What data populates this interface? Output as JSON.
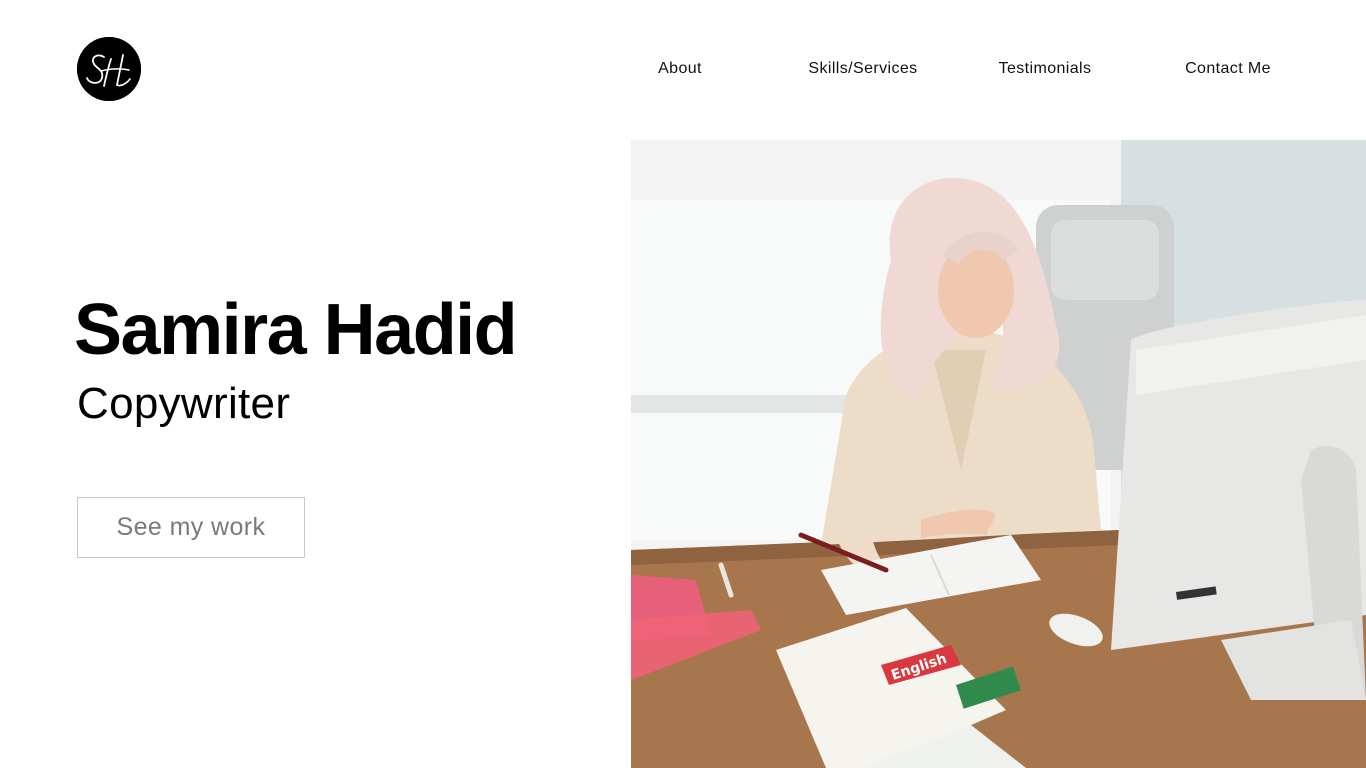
{
  "logo": {
    "monogram": "SH"
  },
  "nav": {
    "items": [
      "About",
      "Skills/Services",
      "Testimonials",
      "Contact Me"
    ]
  },
  "hero": {
    "name": "Samira Hadid",
    "role": "Copywriter",
    "cta_label": "See my work"
  },
  "photo": {
    "subject": "woman writing at desk with computer",
    "book_cover_text": "English"
  },
  "colors": {
    "text": "#000000",
    "button_text": "#7a7a7a",
    "button_border": "#c8c8c8",
    "desk": "#a7764c",
    "background": "#ffffff"
  }
}
